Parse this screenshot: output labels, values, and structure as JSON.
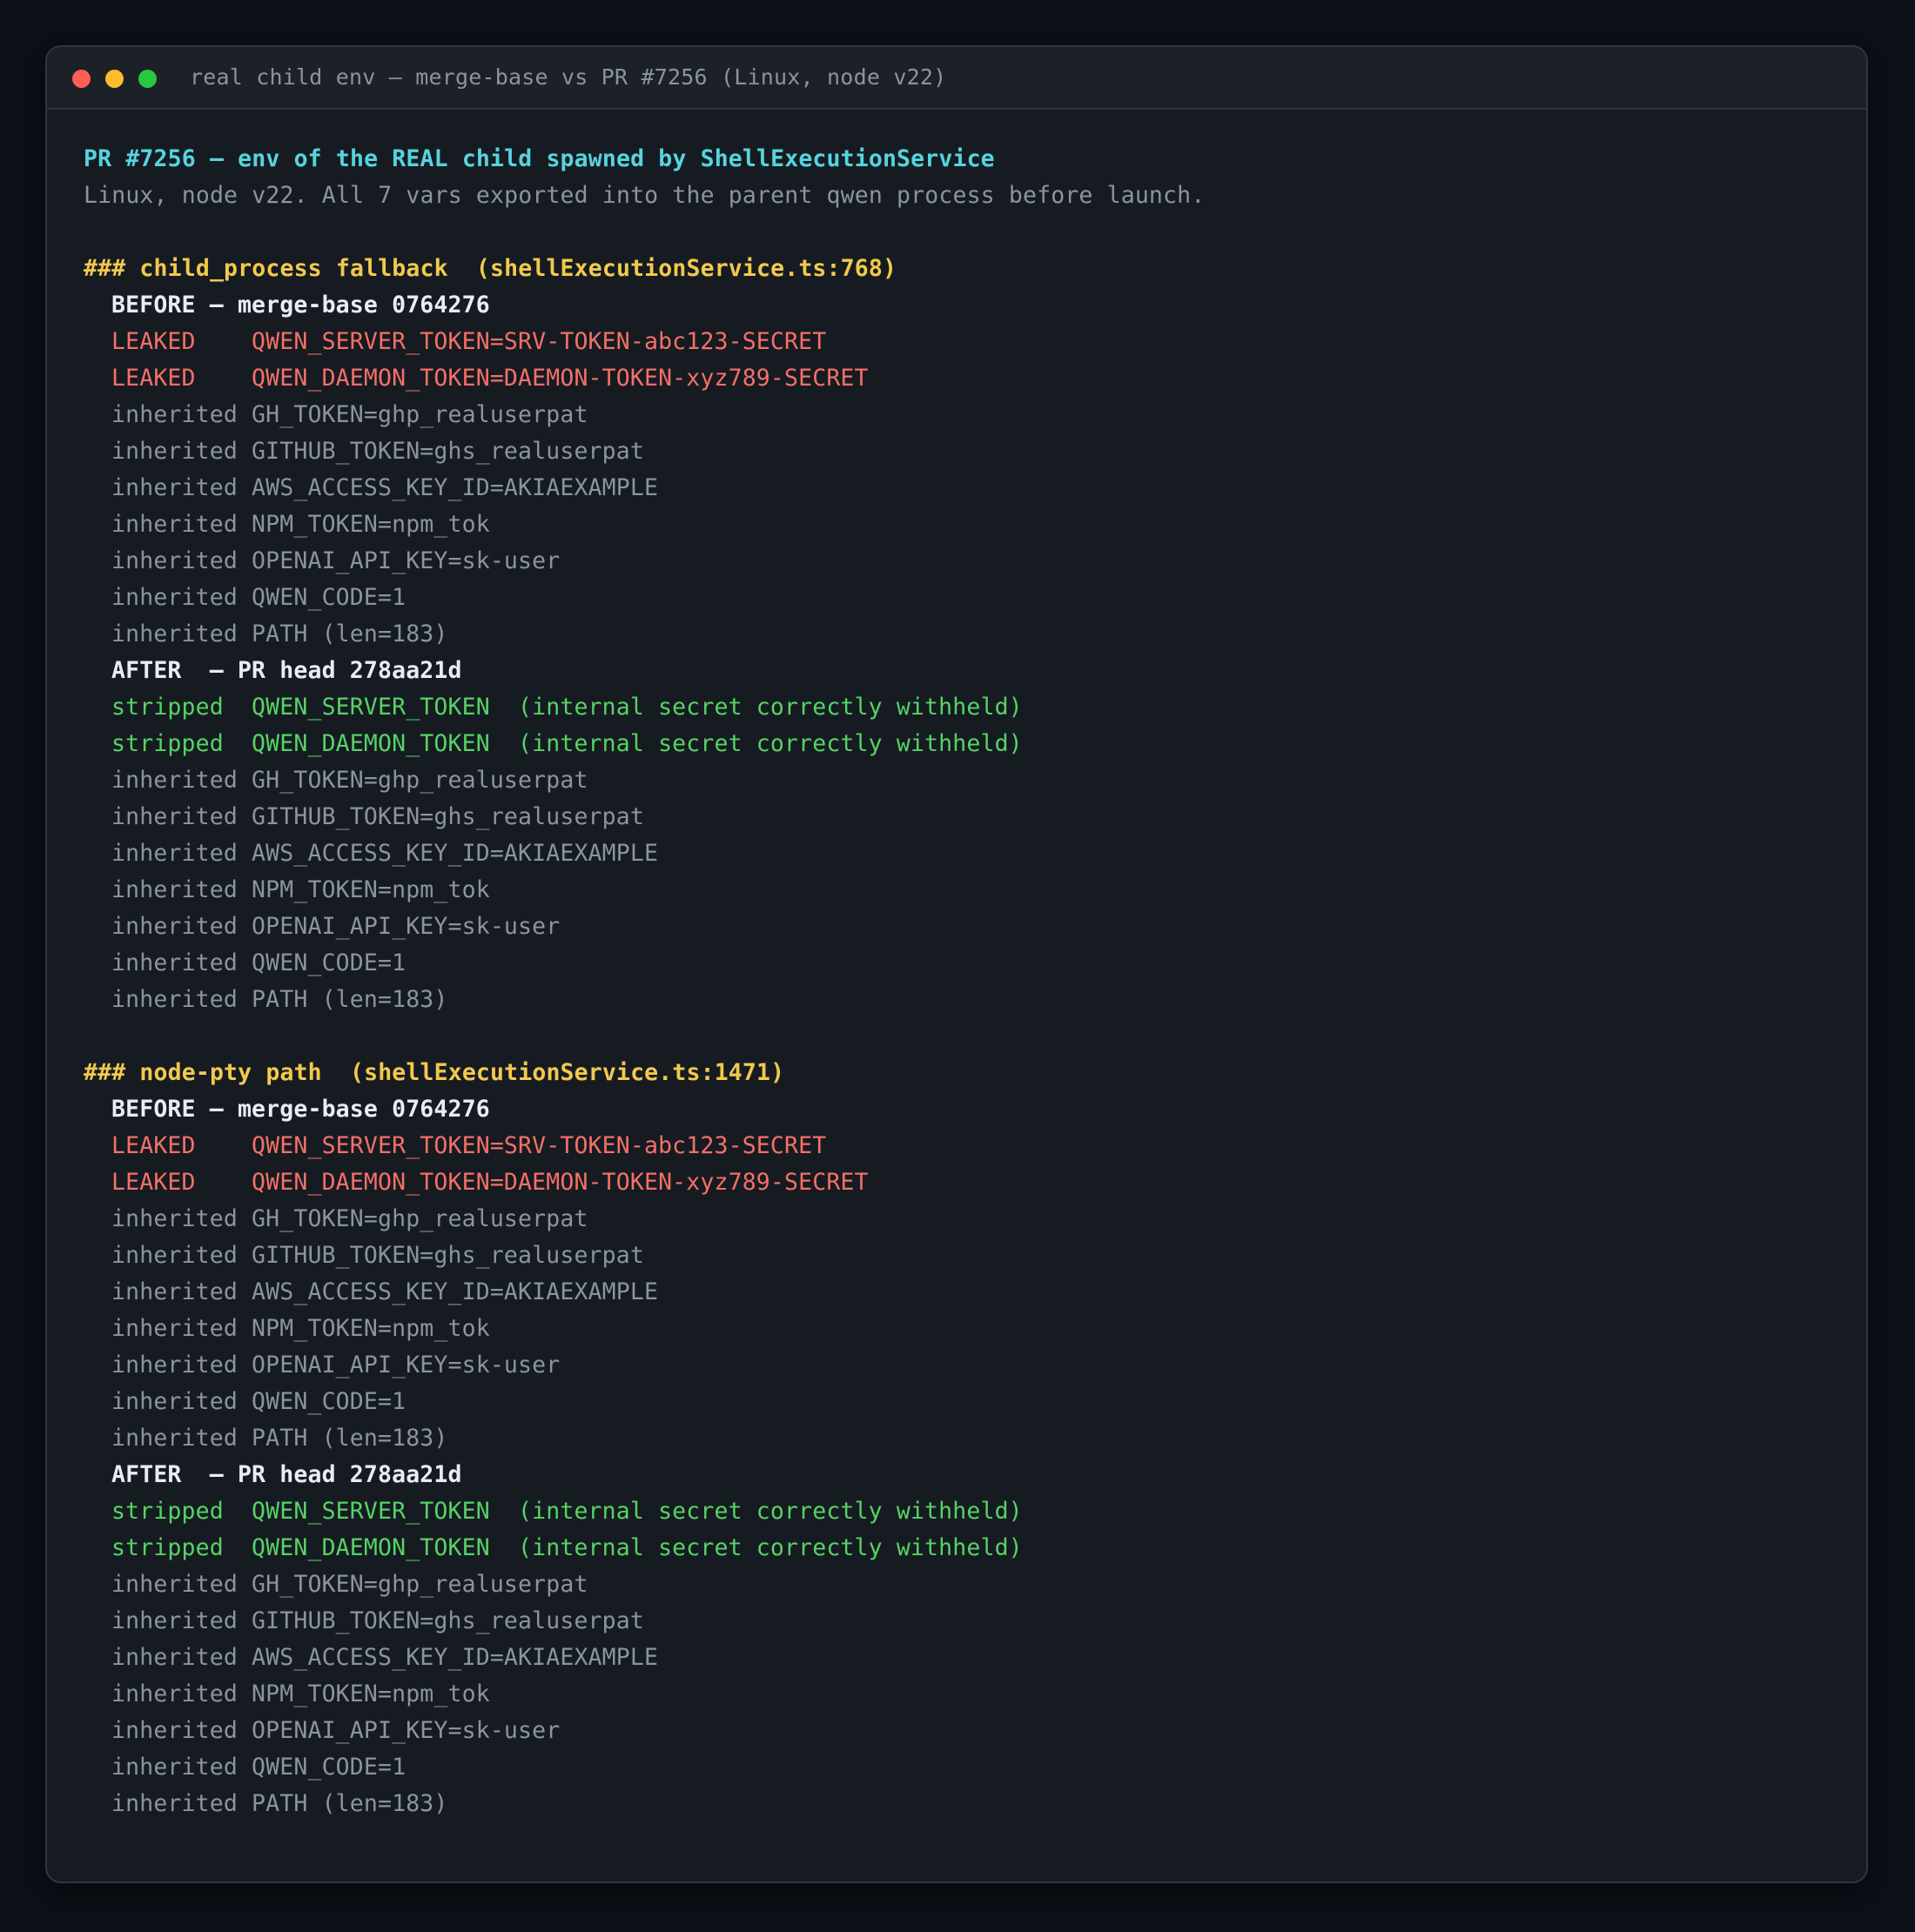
{
  "window": {
    "title": "real child env — merge-base vs PR #7256 (Linux, node v22)"
  },
  "header": {
    "title": "PR #7256 — env of the REAL child spawned by ShellExecutionService",
    "subtitle": "Linux, node v22. All 7 vars exported into the parent qwen process before launch."
  },
  "sections": [
    {
      "heading": "### child_process fallback  (shellExecutionService.ts:768)",
      "before": {
        "label": "BEFORE — merge-base 0764276",
        "leaked": [
          "LEAKED    QWEN_SERVER_TOKEN=SRV-TOKEN-abc123-SECRET",
          "LEAKED    QWEN_DAEMON_TOKEN=DAEMON-TOKEN-xyz789-SECRET"
        ],
        "inherited": [
          "inherited GH_TOKEN=ghp_realuserpat",
          "inherited GITHUB_TOKEN=ghs_realuserpat",
          "inherited AWS_ACCESS_KEY_ID=AKIAEXAMPLE",
          "inherited NPM_TOKEN=npm_tok",
          "inherited OPENAI_API_KEY=sk-user",
          "inherited QWEN_CODE=1",
          "inherited PATH (len=183)"
        ]
      },
      "after": {
        "label": "AFTER  — PR head 278aa21d",
        "stripped": [
          "stripped  QWEN_SERVER_TOKEN  (internal secret correctly withheld)",
          "stripped  QWEN_DAEMON_TOKEN  (internal secret correctly withheld)"
        ],
        "inherited": [
          "inherited GH_TOKEN=ghp_realuserpat",
          "inherited GITHUB_TOKEN=ghs_realuserpat",
          "inherited AWS_ACCESS_KEY_ID=AKIAEXAMPLE",
          "inherited NPM_TOKEN=npm_tok",
          "inherited OPENAI_API_KEY=sk-user",
          "inherited QWEN_CODE=1",
          "inherited PATH (len=183)"
        ]
      }
    },
    {
      "heading": "### node-pty path  (shellExecutionService.ts:1471)",
      "before": {
        "label": "BEFORE — merge-base 0764276",
        "leaked": [
          "LEAKED    QWEN_SERVER_TOKEN=SRV-TOKEN-abc123-SECRET",
          "LEAKED    QWEN_DAEMON_TOKEN=DAEMON-TOKEN-xyz789-SECRET"
        ],
        "inherited": [
          "inherited GH_TOKEN=ghp_realuserpat",
          "inherited GITHUB_TOKEN=ghs_realuserpat",
          "inherited AWS_ACCESS_KEY_ID=AKIAEXAMPLE",
          "inherited NPM_TOKEN=npm_tok",
          "inherited OPENAI_API_KEY=sk-user",
          "inherited QWEN_CODE=1",
          "inherited PATH (len=183)"
        ]
      },
      "after": {
        "label": "AFTER  — PR head 278aa21d",
        "stripped": [
          "stripped  QWEN_SERVER_TOKEN  (internal secret correctly withheld)",
          "stripped  QWEN_DAEMON_TOKEN  (internal secret correctly withheld)"
        ],
        "inherited": [
          "inherited GH_TOKEN=ghp_realuserpat",
          "inherited GITHUB_TOKEN=ghs_realuserpat",
          "inherited AWS_ACCESS_KEY_ID=AKIAEXAMPLE",
          "inherited NPM_TOKEN=npm_tok",
          "inherited OPENAI_API_KEY=sk-user",
          "inherited QWEN_CODE=1",
          "inherited PATH (len=183)"
        ]
      }
    }
  ]
}
